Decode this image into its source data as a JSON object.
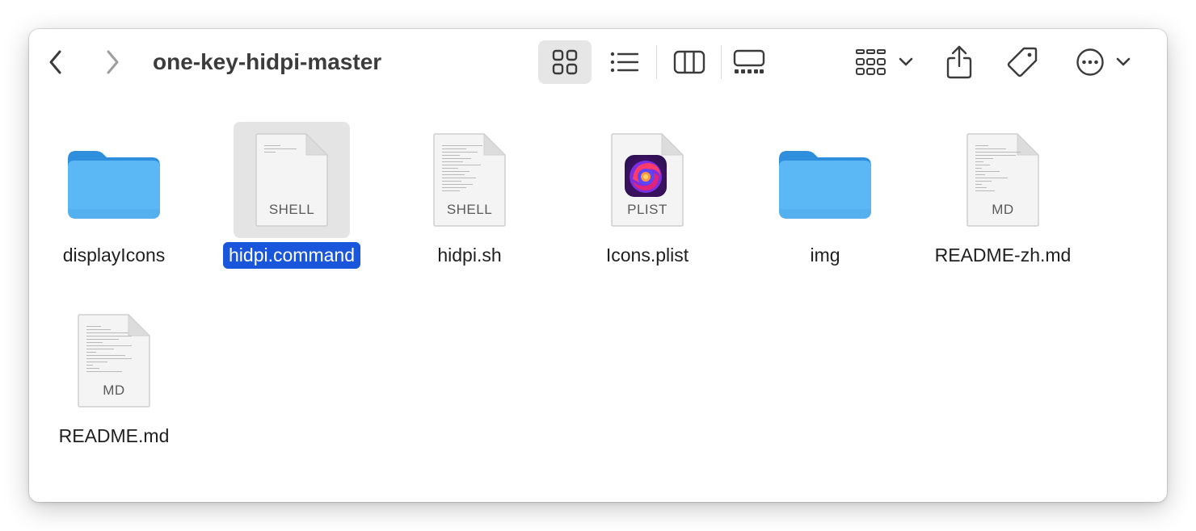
{
  "window": {
    "title": "one-key-hidpi-master"
  },
  "toolbar": {
    "back": "chevron-left-icon",
    "forward": "chevron-right-icon",
    "views": [
      "icon-view",
      "list-view",
      "column-view",
      "gallery-view"
    ],
    "active_view": "icon-view",
    "group": "group-icon",
    "share": "share-icon",
    "tags": "tag-icon",
    "more": "ellipsis-circle-icon"
  },
  "files": [
    {
      "name": "displayIcons",
      "kind": "folder",
      "selected": false
    },
    {
      "name": "hidpi.command",
      "kind": "document",
      "ext": "SHELL",
      "selected": true
    },
    {
      "name": "hidpi.sh",
      "kind": "document",
      "ext": "SHELL",
      "selected": false
    },
    {
      "name": "Icons.plist",
      "kind": "document",
      "ext": "PLIST",
      "selected": false
    },
    {
      "name": "img",
      "kind": "folder",
      "selected": false
    },
    {
      "name": "README-zh.md",
      "kind": "document",
      "ext": "MD",
      "selected": false
    },
    {
      "name": "README.md",
      "kind": "document",
      "ext": "MD",
      "selected": false
    }
  ],
  "colors": {
    "selection": "#1a56db",
    "folder": "#5cb8f5",
    "selected_tile": "#e4e4e4"
  }
}
